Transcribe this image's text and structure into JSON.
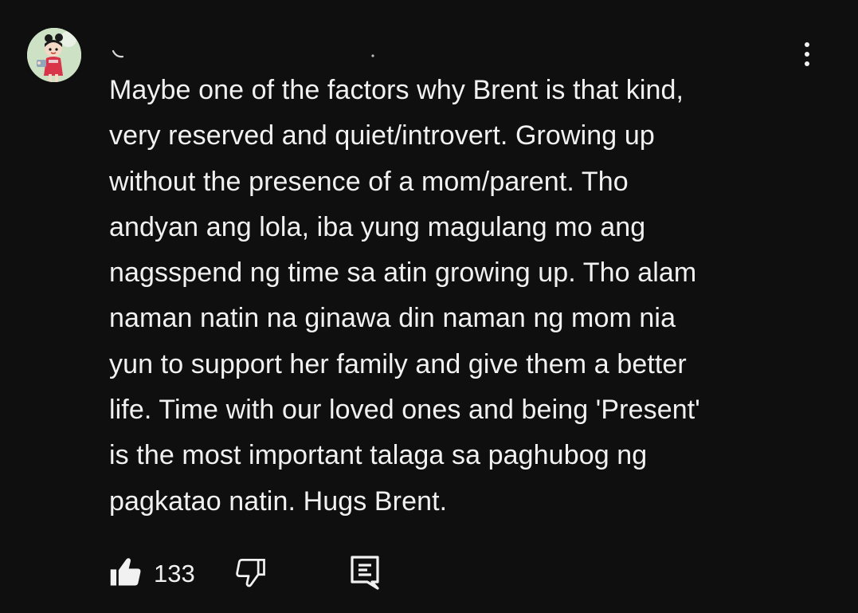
{
  "comment": {
    "avatar_icon": "cartoon-avatar-icon",
    "more_icon": "more-vert-icon",
    "text_lines": [
      "Maybe one of the factors why Brent is that kind,",
      "very reserved and quiet/introvert. Growing up",
      "without the presence of a mom/parent. Tho",
      "andyan ang lola, iba yung magulang mo ang",
      "nagsspend ng time sa atin growing up. Tho alam",
      "naman natin na ginawa din naman ng mom nia",
      "yun to support her family and give them a better",
      "life. Time with our loved ones and being 'Present'",
      "is the most important talaga sa paghubog ng",
      "pagkatao natin. Hugs Brent."
    ]
  },
  "actions": {
    "like_icon": "thumbs-up-icon",
    "like_count": "133",
    "dislike_icon": "thumbs-down-icon",
    "reply_icon": "reply-comment-icon"
  },
  "colors": {
    "background": "#0f0f0f",
    "text": "#f1f1f1"
  }
}
